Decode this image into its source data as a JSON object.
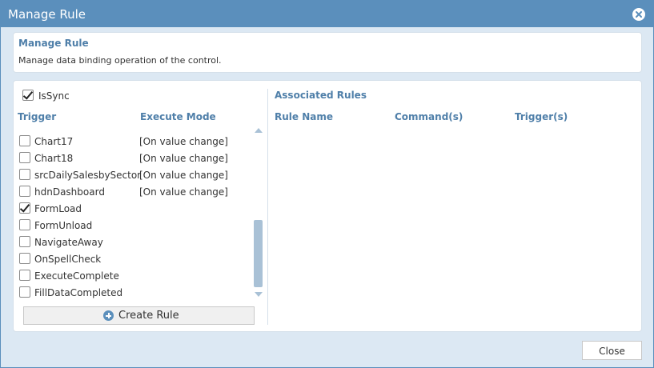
{
  "dialog": {
    "title": "Manage Rule",
    "colors": {
      "titlebar": "#5b8fbc",
      "accent_text": "#4f7fa9",
      "body_bg": "#dce8f3"
    }
  },
  "info": {
    "title": "Manage Rule",
    "description": "Manage data binding operation of the control."
  },
  "left": {
    "issync_label": "IsSync",
    "issync_checked": true,
    "header_trigger": "Trigger",
    "header_mode": "Execute Mode",
    "rows": [
      {
        "name": "Chart17",
        "mode": "[On value change]",
        "checked": false
      },
      {
        "name": "Chart18",
        "mode": "[On value change]",
        "checked": false
      },
      {
        "name": "srcDailySalesbySector",
        "mode": "[On value change]",
        "checked": false
      },
      {
        "name": "hdnDashboard",
        "mode": "[On value change]",
        "checked": false
      },
      {
        "name": "FormLoad",
        "mode": "",
        "checked": true
      },
      {
        "name": "FormUnload",
        "mode": "",
        "checked": false
      },
      {
        "name": "NavigateAway",
        "mode": "",
        "checked": false
      },
      {
        "name": "OnSpellCheck",
        "mode": "",
        "checked": false
      },
      {
        "name": "ExecuteComplete",
        "mode": "",
        "checked": false
      },
      {
        "name": "FillDataCompleted",
        "mode": "",
        "checked": false
      }
    ],
    "create_label": "Create Rule",
    "icons": {
      "create": "plus-circle-icon",
      "scroll_up": "scroll-up-arrow-icon",
      "scroll_down": "scroll-down-arrow-icon"
    }
  },
  "right": {
    "title": "Associated Rules",
    "col_rule": "Rule Name",
    "col_commands": "Command(s)",
    "col_triggers": "Trigger(s)"
  },
  "footer": {
    "close_label": "Close"
  },
  "icons": {
    "dialog_close": "close-circle-icon"
  }
}
